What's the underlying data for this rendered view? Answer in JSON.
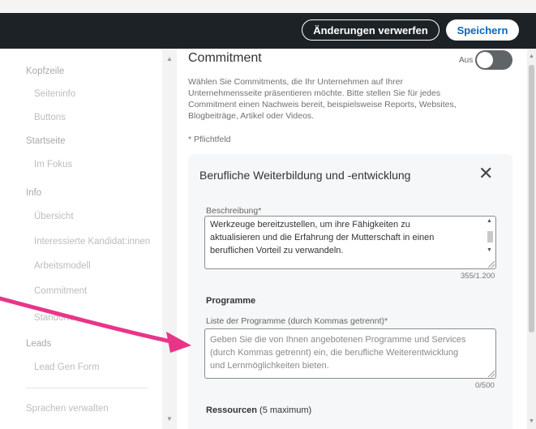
{
  "header": {
    "discard_label": "Änderungen verwerfen",
    "save_label": "Speichern"
  },
  "sidebar": {
    "items": [
      {
        "label": "Kopfzeile",
        "level": 0
      },
      {
        "label": "Seiteninfo",
        "level": 1
      },
      {
        "label": "Buttons",
        "level": 1
      },
      {
        "label": "Startseite",
        "level": 0
      },
      {
        "label": "Im Fokus",
        "level": 1
      },
      {
        "label": "Info",
        "level": 0
      },
      {
        "label": "Übersicht",
        "level": 1
      },
      {
        "label": "Interessierte Kandidat:innen",
        "level": 1
      },
      {
        "label": "Arbeitsmodell",
        "level": 1
      },
      {
        "label": "Commitment",
        "level": 1
      },
      {
        "label": "Standorte",
        "level": 1
      },
      {
        "label": "Leads",
        "level": 0
      },
      {
        "label": "Lead Gen Form",
        "level": 1
      },
      {
        "label": "Sprachen verwalten",
        "level": 0
      }
    ]
  },
  "commitment": {
    "title": "Commitment",
    "toggle_label": "Aus",
    "toggle_on": false,
    "description_lines": [
      "Wählen Sie Commitments, die Ihr Unternehmen auf Ihrer",
      "Unternehmensseite präsentieren möchte. Bitte stellen Sie für jedes",
      "Commitment einen Nachweis bereit, beispielsweise Reports, Websites,",
      "Blogbeiträge, Artikel oder Videos."
    ],
    "required_note": "* Pflichtfeld"
  },
  "card": {
    "title": "Berufliche Weiterbildung und -entwicklung",
    "close_icon": "close-icon",
    "description": {
      "label": "Beschreibung*",
      "lines": [
        "Werkzeuge bereitzustellen, um ihre Fähigkeiten zu",
        "aktualisieren und die Erfahrung der Mutterschaft in einen",
        "beruflichen Vorteil zu verwandeln."
      ],
      "counter": "355/1.200"
    },
    "programs": {
      "heading": "Programme",
      "label": "Liste der Programme (durch Kommas getrennt)*",
      "placeholder_lines": [
        "Geben Sie die von Ihnen angebotenen Programme und Services",
        "(durch Kommas getrennt) ein, die berufliche Weiterentwicklung",
        "und Lernmöglichkeiten bieten."
      ],
      "counter": "0/500"
    },
    "resources": {
      "heading": "Ressourcen",
      "limit": "(5 maximum)"
    }
  },
  "colors": {
    "topbar": "#1d2226",
    "accent": "#0a66c2",
    "arrow": "#e8358a",
    "toggle_off": "#5f6467"
  }
}
